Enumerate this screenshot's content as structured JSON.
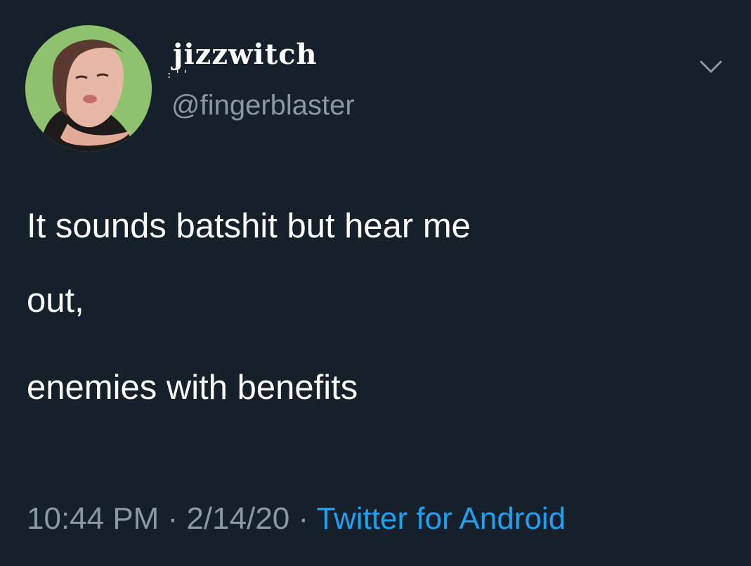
{
  "tweet": {
    "display_name": "jizzwitch",
    "display_name_marks": ": ' '",
    "handle": "@fingerblaster",
    "text_lines": [
      "It sounds batshit but hear me",
      "out,",
      "enemies with benefits"
    ],
    "time": "10:44 PM",
    "separator": " · ",
    "date": "2/14/20",
    "source": "Twitter for Android"
  },
  "icons": {
    "menu": "chevron-down-icon",
    "avatar": "profile-photo"
  },
  "colors": {
    "background": "#15202b",
    "text": "#ffffff",
    "secondary": "#8899a6",
    "link": "#1da1f2"
  }
}
